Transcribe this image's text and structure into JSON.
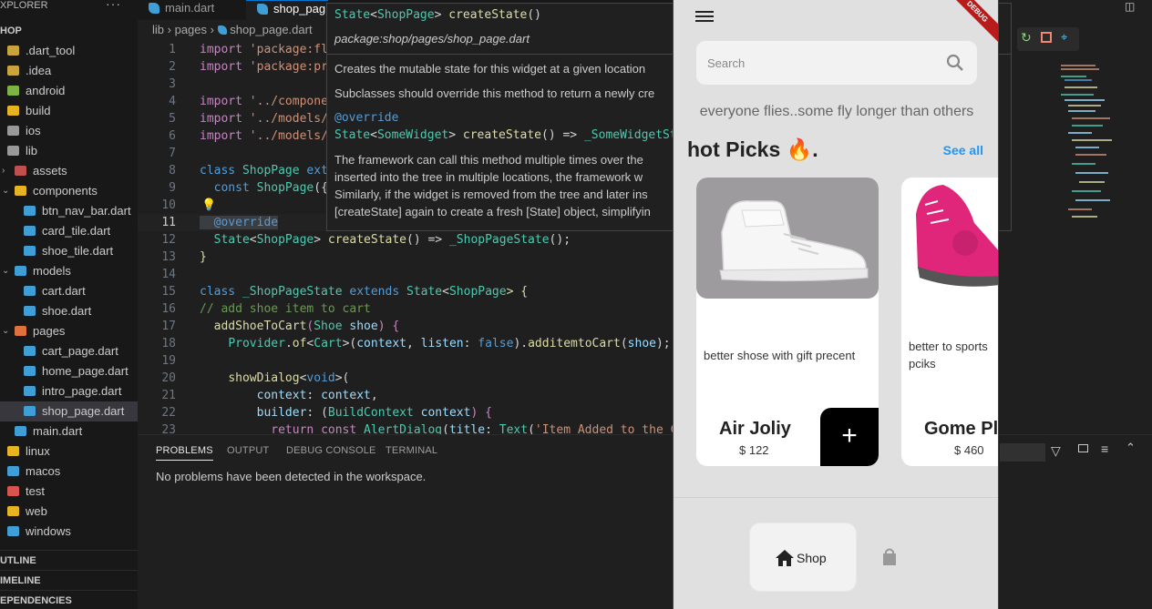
{
  "explorer": {
    "title": "XPLORER",
    "more": "···",
    "items": [
      {
        "label": ".dart_tool",
        "color": "#c9a43c"
      },
      {
        "label": ".idea",
        "color": "#c9a43c"
      },
      {
        "label": "android",
        "color": "#7cb342"
      },
      {
        "label": "build",
        "color": "#e6b422"
      },
      {
        "label": "ios",
        "color": "#999999"
      },
      {
        "label": "lib",
        "color": "#999999"
      },
      {
        "label": "assets",
        "color": "#c0504d"
      },
      {
        "label": "components",
        "color": "#e6b422"
      },
      {
        "label": "btn_nav_bar.dart",
        "color": "#3f9ed6"
      },
      {
        "label": "card_tile.dart",
        "color": "#3f9ed6"
      },
      {
        "label": "shoe_tile.dart",
        "color": "#3f9ed6"
      },
      {
        "label": "models",
        "color": "#3f9ed6"
      },
      {
        "label": "cart.dart",
        "color": "#3f9ed6"
      },
      {
        "label": "shoe.dart",
        "color": "#3f9ed6"
      },
      {
        "label": "pages",
        "color": "#e0703c"
      },
      {
        "label": "cart_page.dart",
        "color": "#3f9ed6"
      },
      {
        "label": "home_page.dart",
        "color": "#3f9ed6"
      },
      {
        "label": "intro_page.dart",
        "color": "#3f9ed6"
      },
      {
        "label": "shop_page.dart",
        "color": "#3f9ed6"
      },
      {
        "label": "main.dart",
        "color": "#3f9ed6"
      },
      {
        "label": "linux",
        "color": "#e6b422"
      },
      {
        "label": "macos",
        "color": "#3f9ed6"
      },
      {
        "label": "test",
        "color": "#d9534f"
      },
      {
        "label": "web",
        "color": "#e6b422"
      },
      {
        "label": "windows",
        "color": "#3f9ed6"
      }
    ],
    "root": "HOP",
    "outline": "UTLINE",
    "timeline": "IMELINE",
    "deps": "EPENDENCIES"
  },
  "tabs": {
    "t1": "main.dart",
    "t2": "shop_pag"
  },
  "breadcrumb": {
    "a": "lib",
    "b": "pages",
    "c": "shop_page.dart"
  },
  "code": {
    "n": [
      "1",
      "2",
      "3",
      "4",
      "5",
      "6",
      "7",
      "8",
      "9",
      "10",
      "11",
      "12",
      "13",
      "14",
      "15",
      "16",
      "17",
      "18",
      "19",
      "20",
      "21",
      "22",
      "23"
    ],
    "l1a": "import ",
    "l1b": "'package:fl",
    "l2a": "import ",
    "l2b": "'package:pr",
    "l4a": "import ",
    "l4b": "'../compone",
    "l5a": "import ",
    "l5b": "'../models/",
    "l6a": "import ",
    "l6b": "'../models/",
    "l8a": "class ",
    "l8b": "ShopPage ",
    "l8c": "ext",
    "l9a": "  const ",
    "l9b": "ShopPage",
    "l9c": "({",
    "l11": "  @override",
    "l12a": "  State",
    "l12b": "<",
    "l12c": "ShopPage",
    "l12d": "> ",
    "l12e": "createState",
    "l12f": "() => ",
    "l12g": "_ShopPageState",
    "l12h": "();",
    "l13": "}",
    "l15a": "class ",
    "l15b": "_ShopPageState ",
    "l15c": "extends ",
    "l15d": "State",
    "l15e": "<",
    "l15f": "ShopPage",
    "l15g": "> {",
    "l16": "// add shoe item to cart",
    "l17a": "  ",
    "l17b": "addShoeToCart",
    "l17c": "(",
    "l17d": "Shoe ",
    "l17e": "shoe",
    ") {": "",
    "l17f": ") {",
    "l18a": "    ",
    "l18b": "Provider",
    "l18c": ".",
    "l18d": "of",
    "l18e": "<",
    "l18f": "Cart",
    "l18g": ">(",
    "l18h": "context",
    "l18i": ", ",
    "l18j": "listen",
    "l18k": ": ",
    "l18l": "false",
    "l18m": ").",
    "l18n": "additemtoCart",
    "l18o": "(",
    "l18p": "shoe",
    "l18q": ");",
    "l20a": "    ",
    "l20b": "showDialog",
    "l20c": "<",
    "l20d": "void",
    "l20e": ">(",
    "l21a": "        ",
    "l21b": "context",
    "l21c": ": ",
    "l21d": "context",
    "l21e": ",",
    "l22a": "        ",
    "l22b": "builder",
    "l22c": ": (",
    "l22d": "BuildContext ",
    "l22e": "context",
    "l22f": ") {",
    "l23a": "          ",
    "l23b": "return const ",
    "l23c": "AlertDialog",
    "l23d": "(",
    "l23e": "title",
    "l23f": ": ",
    "l23g": "Text",
    "l23h": "(",
    "l23i": "'Item Added to the Ca"
  },
  "hover": {
    "sig_a": "State",
    "sig_b": "<",
    "sig_c": "ShopPage",
    "sig_d": "> ",
    "sig_e": "createState",
    "sig_f": "()",
    "path": "package:shop/pages/shop_page.dart",
    "p1": "Creates the mutable state for this widget at a given location",
    "p2": "Subclasses should override this method to return a newly cre",
    "c1": "@override",
    "c2a": "State",
    "c2b": "<",
    "c2c": "SomeWidget",
    "c2d": "> ",
    "c2e": "createState",
    "c2f": "() => ",
    "c2g": "_SomeWidgetSt",
    "p3": "The framework can call this method multiple times over the",
    "p4": "inserted into the tree in multiple locations, the framework w",
    "p5": "Similarly, if the widget is removed from the tree and later ins",
    "p6": "[createState] again to create a fresh [State] object, simplifyin"
  },
  "panel": {
    "tabs": [
      "PROBLEMS",
      "OUTPUT",
      "DEBUG CONSOLE",
      "TERMINAL"
    ],
    "message": "No problems have been detected in the workspace."
  },
  "app": {
    "debug": "DEBUG",
    "search_placeholder": "Search",
    "tagline": "everyone flies..some fly longer than others",
    "hot_picks": "hot Picks 🔥.",
    "see_all": "See all",
    "products": [
      {
        "desc": "better shose with gift precent",
        "name": "Air Joliy",
        "price": "$ 122"
      },
      {
        "desc": "better  to sports pciks",
        "name": "Gome Pla",
        "price": "$ 460"
      }
    ],
    "add": "+",
    "nav": {
      "shop": "Shop"
    }
  },
  "colors": {
    "accent": "#2196f3",
    "debug": "#b71c1c"
  }
}
